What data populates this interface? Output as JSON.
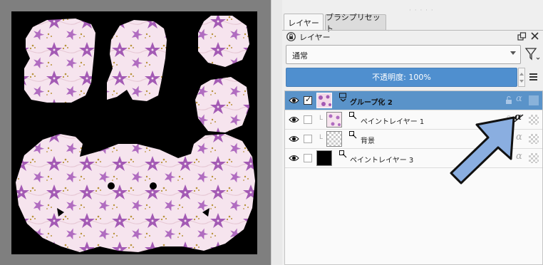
{
  "docker": {
    "tabs": [
      {
        "label": "レイヤー",
        "active": true
      },
      {
        "label": "ブラシプリセット",
        "active": false
      }
    ],
    "title": "レイヤー",
    "blend_mode": {
      "value": "通常"
    },
    "opacity_label": "不透明度: 100%"
  },
  "layers": [
    {
      "name": "グループ化 2",
      "visible": true,
      "checked": true,
      "selected": true,
      "type": "group"
    },
    {
      "name": "ペイントレイヤー 1",
      "visible": true,
      "checked": false,
      "selected": false,
      "type": "paint",
      "alpha_inherit": "crossed"
    },
    {
      "name": "背景",
      "visible": true,
      "checked": false,
      "selected": false,
      "type": "paint"
    },
    {
      "name": "ペイントレイヤー 3",
      "visible": true,
      "checked": false,
      "selected": false,
      "type": "paint"
    }
  ],
  "icons": [
    "lock-icon",
    "float-icon",
    "close-icon",
    "filter-icon",
    "hamburger-menu-icon",
    "eye-icon",
    "alpha-lock-icon",
    "transparency-checker-icon",
    "pointer-arrow"
  ],
  "colors": {
    "accent": "#5a93c9",
    "selection": "#5a93c9",
    "arrow_fill": "#8aaee0",
    "pattern_bg": "#f6e4ee",
    "flower": "#a35ab4"
  }
}
